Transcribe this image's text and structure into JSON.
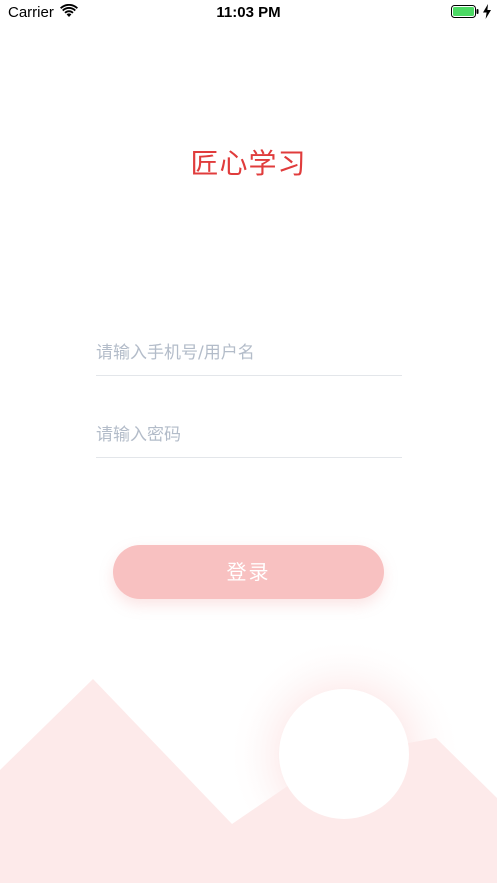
{
  "status_bar": {
    "carrier": "Carrier",
    "time": "11:03 PM",
    "battery_color": "#4cd964"
  },
  "app": {
    "title": "匠心学习",
    "title_color": "#e03c3c"
  },
  "form": {
    "username_placeholder": "请输入手机号/用户名",
    "password_placeholder": "请输入密码",
    "login_label": "登录",
    "button_color": "#f8c1c1"
  },
  "decoration": {
    "mountain_color": "#fdeaea",
    "sun_color": "#ffffff"
  }
}
